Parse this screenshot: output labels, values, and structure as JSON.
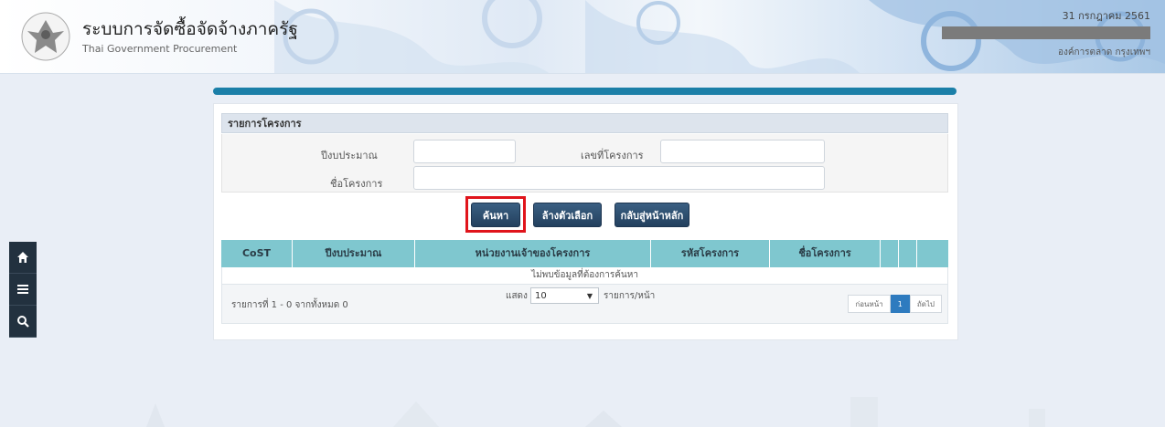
{
  "header": {
    "title_th": "ระบบการจัดซื้อจัดจ้างภาครัฐ",
    "title_en": "Thai Government Procurement",
    "date": "31 กรกฎาคม 2561",
    "org": "องค์การตลาด กรุงเทพฯ"
  },
  "sidebar": {
    "items": [
      {
        "icon": "home-icon"
      },
      {
        "icon": "menu-icon"
      },
      {
        "icon": "search-icon"
      }
    ]
  },
  "panel": {
    "title": "รายการโครงการ",
    "fields": {
      "budget_year_label": "ปีงบประมาณ",
      "budget_year_value": "",
      "project_no_label": "เลขที่โครงการ",
      "project_no_value": "",
      "project_name_label": "ชื่อโครงการ",
      "project_name_value": ""
    },
    "buttons": {
      "search": "ค้นหา",
      "clear": "ล้างตัวเลือก",
      "back_home": "กลับสู่หน้าหลัก"
    }
  },
  "table": {
    "columns": [
      "CoST",
      "ปีงบประมาณ",
      "หน่วยงานเจ้าของโครงการ",
      "รหัสโครงการ",
      "ชื่อโครงการ",
      "",
      ""
    ],
    "empty_message": "ไม่พบข้อมูลที่ต้องการค้นหา",
    "summary": "รายการที่ 1 - 0 จากทั้งหมด 0",
    "show_label": "แสดง",
    "page_size": "10",
    "per_page_label": "รายการ/หน้า",
    "pager": {
      "prev": "ก่อนหน้า",
      "current": "1",
      "next": "ถัดไป"
    }
  },
  "colors": {
    "accent": "#1b7fa8",
    "table_header": "#7fc7cf",
    "button": "#2d4e6e",
    "highlight": "#e0141b",
    "sidebar": "#22313f"
  }
}
